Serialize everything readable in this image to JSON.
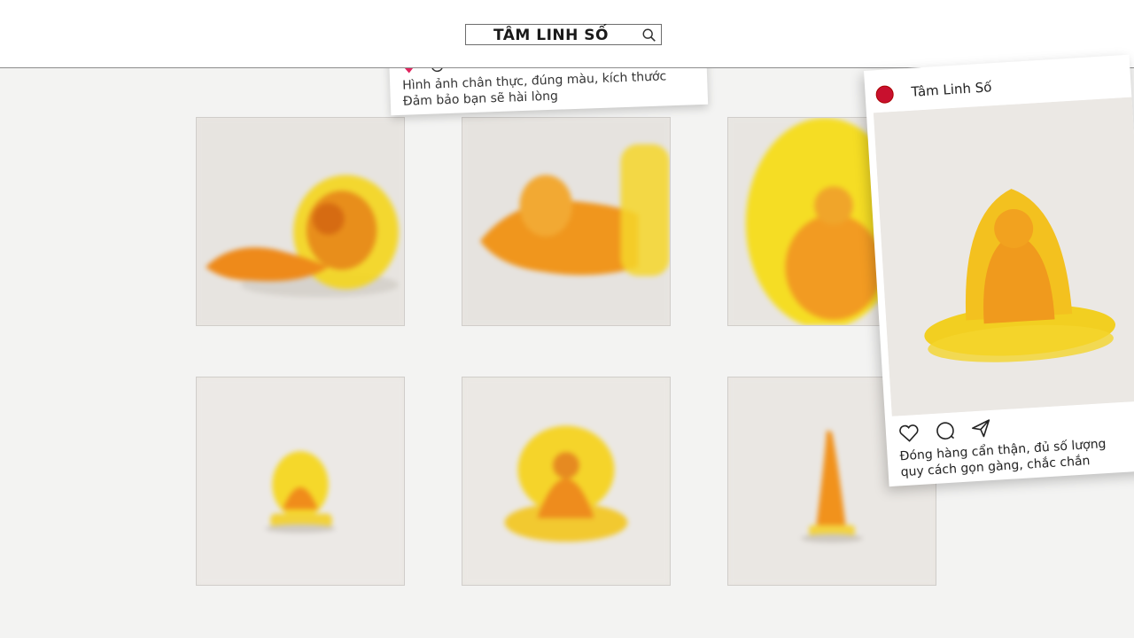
{
  "header": {
    "search_label": "TÂM LINH SỐ",
    "search_icon": "search-icon"
  },
  "post_top": {
    "caption_line1": "Hình ảnh chân thực, đúng màu, kích thước",
    "caption_line2": "Đảm bảo bạn sẽ hài lòng"
  },
  "post_right": {
    "username": "Tâm Linh Số",
    "caption_line1": "Đóng hàng cẩn thận, đủ số lượng",
    "caption_line2": "quy cách gọn gàng, chắc chắn",
    "icons": [
      "heart-icon",
      "comment-icon",
      "share-icon"
    ]
  },
  "colors": {
    "amber": "#f2a11a",
    "yellow": "#f5d21b",
    "orange": "#e07818",
    "avatar_red": "#c8102e"
  },
  "gallery": {
    "tiles": [
      {
        "subject": "amber buddha statue lying on side"
      },
      {
        "subject": "amber buddha statue lying on side"
      },
      {
        "subject": "yellow halo buddha statue close-up"
      },
      {
        "subject": "small amber buddha statue"
      },
      {
        "subject": "amber buddha statue with yellow halo"
      },
      {
        "subject": "amber standing statue"
      }
    ]
  }
}
